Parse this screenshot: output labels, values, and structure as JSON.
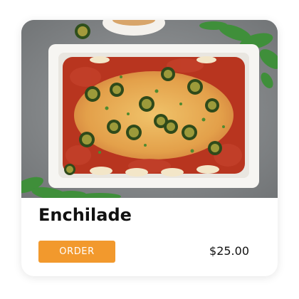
{
  "product_card": {
    "image_alt": "Enchilade",
    "title": "Enchilade",
    "order_label": "ORDER",
    "price": "$25.00"
  },
  "colors": {
    "accent": "#f2992d",
    "title_text": "#111111",
    "card_background": "#ffffff"
  }
}
